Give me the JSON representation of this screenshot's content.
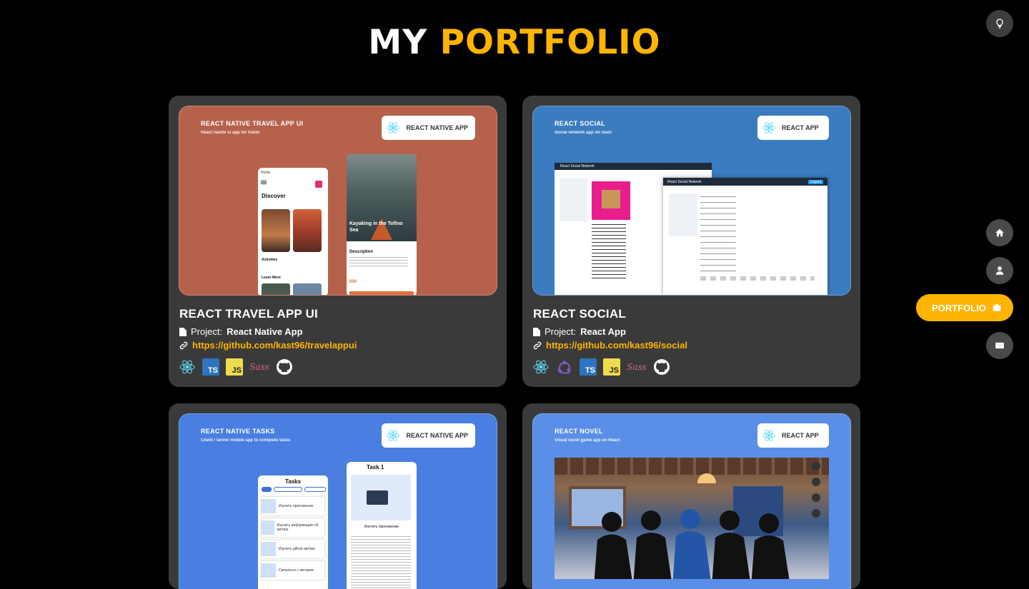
{
  "header": {
    "title_part1": "MY",
    "title_part2": "PORTFOLIO"
  },
  "nav": {
    "active_label": "PORTFOLIO"
  },
  "colors": {
    "accent": "#ffb400",
    "card_bg": "#3a3a3a",
    "travel_bg": "#b5614c",
    "social_bg": "#3b7bbf",
    "tasks_bg": "#4a7ee0",
    "novel_bg": "#5b8ee6"
  },
  "projects": [
    {
      "title": "REACT TRAVEL APP UI",
      "project_label": "Project:",
      "project_type": "React Native App",
      "link": "https://github.com/kast96/travelappui",
      "preview_title": "REACT NATIVE TRAVEL APP UI",
      "preview_subtitle": "React navite ui app for travel",
      "badge": "REACT NATIVE APP",
      "techs": [
        "react-icon",
        "ts-icon",
        "js-icon",
        "sass-icon",
        "github-icon"
      ],
      "phone1": {
        "top": "Home",
        "heading": "Discover",
        "section1": "Activities",
        "section2": "Learn More"
      },
      "phone2": {
        "caption": "Kayaking in the Tofino Sea",
        "description": "Description",
        "price": "$50"
      }
    },
    {
      "title": "REACT SOCIAL",
      "project_label": "Project:",
      "project_type": "React App",
      "link": "https://github.com/kast96/social",
      "preview_title": "REACT SOCIAL",
      "preview_subtitle": "Social network app on react",
      "badge": "REACT APP",
      "techs": [
        "react-icon",
        "redux-icon",
        "ts-icon",
        "js-icon",
        "sass-icon",
        "github-icon"
      ],
      "window_title": "React Social Network",
      "login": "Logout"
    },
    {
      "preview_title": "REACT NATIVE TASKS",
      "preview_subtitle": "Client / server mobile app to complete tasks",
      "badge": "REACT NATIVE APP",
      "phone1": {
        "heading": "Tasks",
        "items": [
          "Изучить приложение",
          "Изучить информацию об авторе",
          "Изучить github автора",
          "Связаться с автором"
        ]
      },
      "phone2": {
        "heading": "Task 1",
        "subtitle": "Изучить приложение"
      }
    },
    {
      "preview_title": "REACT NOVEL",
      "preview_subtitle": "Visual novel game app on React",
      "badge": "REACT APP"
    }
  ]
}
